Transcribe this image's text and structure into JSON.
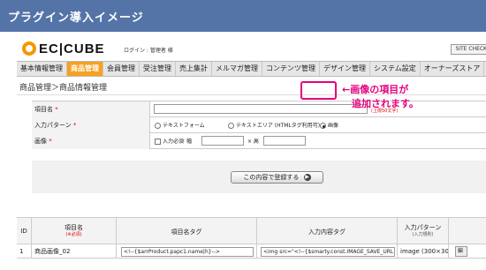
{
  "banner": {
    "title": "プラグイン導入イメージ"
  },
  "app": {
    "logo_text": "EC|CUBE",
    "login_text": "ログイン : 管理者 様",
    "site_check": "SITE CHECK"
  },
  "menu": {
    "items": [
      {
        "label": "基本情報管理",
        "active": false
      },
      {
        "label": "商品管理",
        "active": true
      },
      {
        "label": "会員管理",
        "active": false
      },
      {
        "label": "受注管理",
        "active": false
      },
      {
        "label": "売上集計",
        "active": false
      },
      {
        "label": "メルマガ管理",
        "active": false
      },
      {
        "label": "コンテンツ管理",
        "active": false
      },
      {
        "label": "デザイン管理",
        "active": false
      },
      {
        "label": "システム設定",
        "active": false
      },
      {
        "label": "オーナーズストア",
        "active": false
      }
    ]
  },
  "breadcrumb": "商品管理＞商品情報管理",
  "form": {
    "item_name_label": "項目名",
    "item_name_hint": "(上限50文字)",
    "input_pattern_label": "入力パターン",
    "pattern_options": [
      "テキストフォーム",
      "テキストエリア (HTMLタグ利用可)",
      "画像"
    ],
    "pattern_selected": "画像",
    "image_label": "画像",
    "image_required": "入力必須",
    "width_label": "幅",
    "height_label": "× 高",
    "required_mark": "*"
  },
  "callout": {
    "line1": "←画像の項目が",
    "line2": "追加されます。"
  },
  "save_button": "この内容で登録する",
  "table": {
    "headers": [
      {
        "label": "ID",
        "sub": ""
      },
      {
        "label": "項目名",
        "sub": "(※必須)"
      },
      {
        "label": "項目名タグ",
        "sub": ""
      },
      {
        "label": "入力内容タグ",
        "sub": ""
      },
      {
        "label": "入力パターン",
        "sub": "(入力規則)"
      }
    ],
    "rows": [
      {
        "id": "1",
        "name": "商品画像_02",
        "name_tag": "<!--{$arrProduct.papc1.name|h}-->",
        "content_tag": "<img src=\"<!--{$smarty.const.IMAGE_SAVE_URL}-->",
        "pattern": "image (300×300)",
        "action": "編"
      }
    ]
  },
  "colors": {
    "banner": "#5474a8",
    "active_menu": "#f7a120",
    "accent": "#e5007f",
    "required": "#e00000"
  }
}
